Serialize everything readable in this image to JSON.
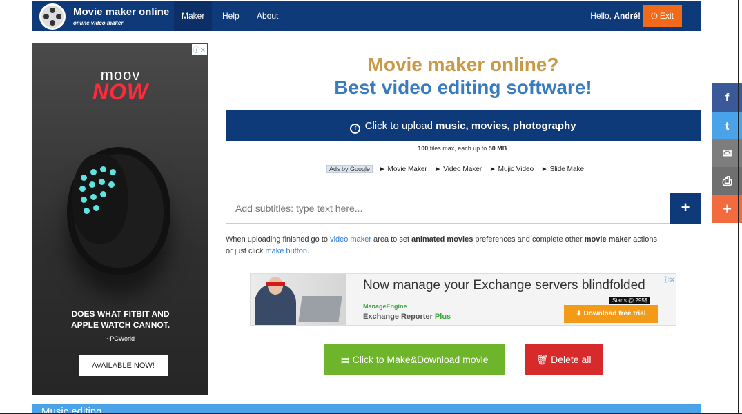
{
  "header": {
    "brand_title": "Movie maker online",
    "brand_subtitle": "online video maker",
    "nav": [
      "Maker",
      "Help",
      "About"
    ],
    "greeting_prefix": "Hello,",
    "user_name": "André!",
    "exit_label": "Exit"
  },
  "left_ad": {
    "brand_top": "moov",
    "brand_bottom": "NOW",
    "tagline_line1": "DOES WHAT FITBIT AND",
    "tagline_line2": "APPLE WATCH CANNOT.",
    "source": "~PCWorld",
    "cta": "AVAILABLE NOW!",
    "close_glyph": "ⓘ✕"
  },
  "main": {
    "headline_1": "Movie maker online?",
    "headline_2": "Best video editing software!",
    "upload": {
      "prefix": "Click to upload ",
      "bold": "music, movies, photography"
    },
    "limits": {
      "count": "100",
      "mid": " files max, each up to ",
      "size": "50 MB",
      "end": "."
    },
    "ads_row": {
      "badge": "Ads by Google",
      "links": [
        "► Movie Maker",
        "► Video Maker",
        "► Mujic Video",
        "► Slide Make"
      ]
    },
    "subtitle_placeholder": "Add subtitles: type text here...",
    "add_label": "+",
    "info": {
      "t1": "When uploading finished go to ",
      "link1": "video maker",
      "t2": " area to set ",
      "b1": "animated movies",
      "t3": " preferences and complete other ",
      "b2": "movie maker",
      "t4": " actions",
      "t5": "or just click ",
      "link2": "make button",
      "t6": "."
    },
    "mid_ad": {
      "title": "Now manage your Exchange servers blindfolded",
      "brand": "ManageEngine",
      "product": "Exchange Reporter ",
      "product_plus": "Plus",
      "price": "Starts @ 295$",
      "cta": "⬇ Download free trial",
      "close_glyph": "ⓘ✕"
    },
    "make_label": "Click to Make&Download movie",
    "delete_label": "Delete all",
    "music_section": "Music editing"
  },
  "share": {
    "facebook": "f",
    "twitter": "t",
    "email": "✉",
    "print": "⎙",
    "more": "+"
  },
  "colors": {
    "nav_bg": "#0f3a7a",
    "exit": "#f06a1a",
    "headline_gold": "#c89a48",
    "headline_blue": "#3a7bbf",
    "make_green": "#6fb52b",
    "delete_red": "#d72b2b"
  }
}
